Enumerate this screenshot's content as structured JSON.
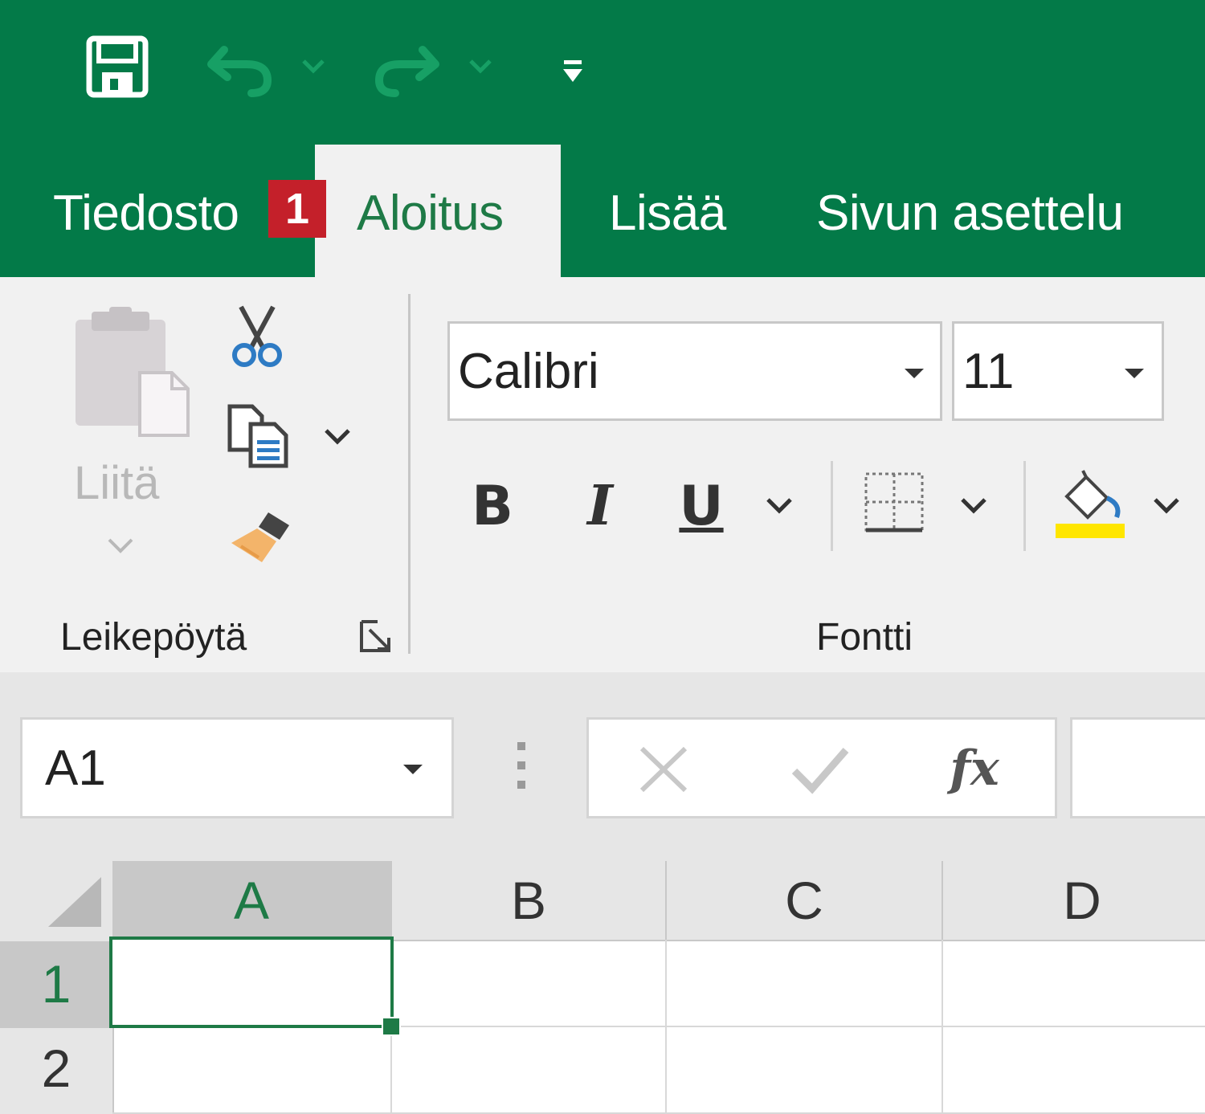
{
  "qat": {
    "save": "save-icon",
    "undo": "undo-icon",
    "redo": "redo-icon",
    "customize": "customize-qat-icon"
  },
  "tabs": [
    {
      "label": "Tiedosto",
      "badge": "1"
    },
    {
      "label": "Aloitus",
      "active": true
    },
    {
      "label": "Lisää"
    },
    {
      "label": "Sivun asettelu"
    }
  ],
  "clipboard": {
    "paste_label": "Liitä",
    "group_label": "Leikepöytä"
  },
  "font": {
    "name": "Calibri",
    "size": "11",
    "bold": "B",
    "italic": "I",
    "underline": "U",
    "group_label": "Fontti",
    "highlight_color": "#ffe600"
  },
  "formula_bar": {
    "name_box": "A1",
    "fx": "fx",
    "value": ""
  },
  "grid": {
    "columns": [
      "A",
      "B",
      "C",
      "D"
    ],
    "rows": [
      "1",
      "2"
    ],
    "selected_cell": "A1"
  },
  "colors": {
    "brand": "#037a48",
    "active_tab_text": "#1e7a46",
    "badge": "#c4202a"
  }
}
